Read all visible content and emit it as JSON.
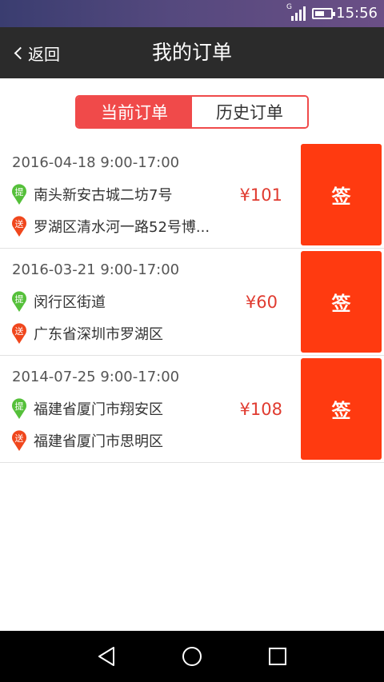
{
  "status_bar": {
    "time": "15:56",
    "signal_label": "G",
    "battery_level": 0.6
  },
  "header": {
    "back_label": "返回",
    "title": "我的订单"
  },
  "tabs": [
    {
      "label": "当前订单",
      "active": true
    },
    {
      "label": "历史订单",
      "active": false
    }
  ],
  "orders": [
    {
      "date": "2016-04-18 9:00-17:00",
      "pickup_badge": "提",
      "pickup": "南头新安古城二坊7号",
      "deliver_badge": "送",
      "deliver": "罗湖区清水河一路52号博...",
      "price": "¥101",
      "action": "签"
    },
    {
      "date": "2016-03-21 9:00-17:00",
      "pickup_badge": "提",
      "pickup": "闵行区街道",
      "deliver_badge": "送",
      "deliver": "广东省深圳市罗湖区",
      "price": "¥60",
      "action": "签"
    },
    {
      "date": "2014-07-25 9:00-17:00",
      "pickup_badge": "提",
      "pickup": "福建省厦门市翔安区",
      "deliver_badge": "送",
      "deliver": "福建省厦门市思明区",
      "price": "¥108",
      "action": "签"
    }
  ],
  "colors": {
    "accent": "#f04a4a",
    "sign_button": "#ff3a10",
    "price": "#e03b30",
    "pickup_pin": "#55c03a",
    "deliver_pin": "#f0471d"
  },
  "system_nav": {
    "icons": [
      "back-triangle-icon",
      "home-circle-icon",
      "recents-square-icon"
    ]
  }
}
